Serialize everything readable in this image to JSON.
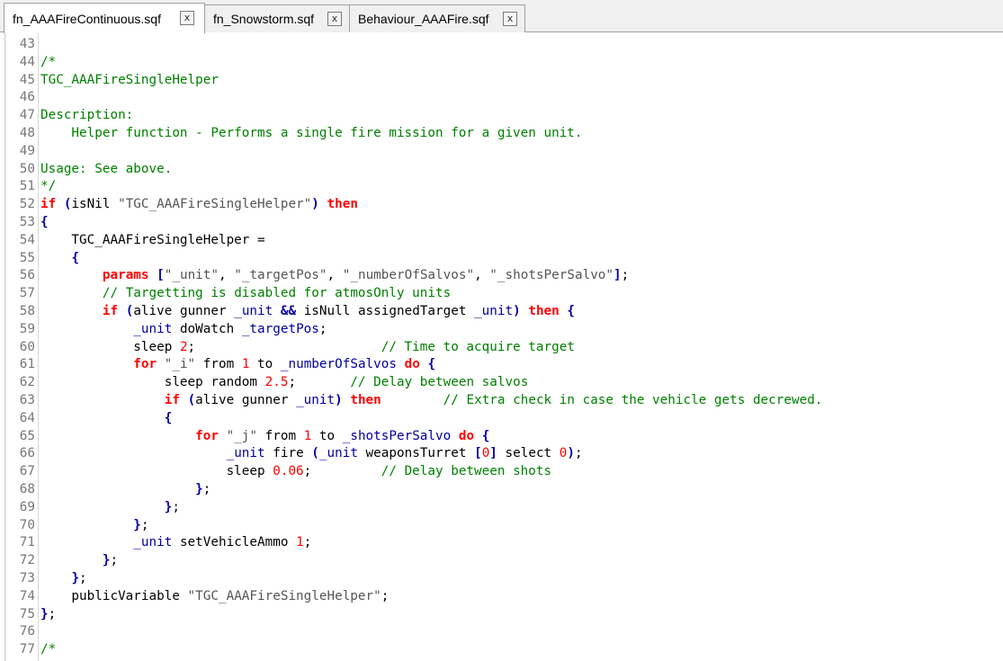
{
  "tabs": [
    {
      "label": "fn_AAAFireContinuous.sqf",
      "close": "x",
      "active": true
    },
    {
      "label": "fn_Snowstorm.sqf",
      "close": "x",
      "active": false
    },
    {
      "label": "Behaviour_AAAFire.sqf",
      "close": "x",
      "active": false
    }
  ],
  "colors": {
    "comment": "#008000",
    "keyword": "#ff0000",
    "number": "#ff0000",
    "string": "#555555",
    "variable": "#0000a0",
    "operator": "#0000a0",
    "line_number": "#777777"
  },
  "lines": [
    {
      "n": "43",
      "tokens": []
    },
    {
      "n": "44",
      "tokens": [
        {
          "t": "cmt",
          "v": "/*"
        }
      ]
    },
    {
      "n": "45",
      "tokens": [
        {
          "t": "cmt",
          "v": "TGC_AAAFireSingleHelper"
        }
      ]
    },
    {
      "n": "46",
      "tokens": []
    },
    {
      "n": "47",
      "tokens": [
        {
          "t": "cmt",
          "v": "Description:"
        }
      ]
    },
    {
      "n": "48",
      "tokens": [
        {
          "t": "cmt",
          "v": "    Helper function - Performs a single fire mission for a given unit."
        }
      ]
    },
    {
      "n": "49",
      "tokens": []
    },
    {
      "n": "50",
      "tokens": [
        {
          "t": "cmt",
          "v": "Usage: See above."
        }
      ]
    },
    {
      "n": "51",
      "tokens": [
        {
          "t": "cmt",
          "v": "*/"
        }
      ]
    },
    {
      "n": "52",
      "tokens": [
        {
          "t": "kw",
          "v": "if"
        },
        {
          "t": "plain",
          "v": " "
        },
        {
          "t": "op",
          "v": "("
        },
        {
          "t": "plain",
          "v": "isNil "
        },
        {
          "t": "str",
          "v": "\"TGC_AAAFireSingleHelper\""
        },
        {
          "t": "op",
          "v": ")"
        },
        {
          "t": "plain",
          "v": " "
        },
        {
          "t": "kw",
          "v": "then"
        }
      ]
    },
    {
      "n": "53",
      "tokens": [
        {
          "t": "op",
          "v": "{"
        }
      ]
    },
    {
      "n": "54",
      "tokens": [
        {
          "t": "plain",
          "v": "    TGC_AAAFireSingleHelper ="
        }
      ]
    },
    {
      "n": "55",
      "tokens": [
        {
          "t": "plain",
          "v": "    "
        },
        {
          "t": "op",
          "v": "{"
        }
      ]
    },
    {
      "n": "56",
      "tokens": [
        {
          "t": "plain",
          "v": "        "
        },
        {
          "t": "kw",
          "v": "params"
        },
        {
          "t": "plain",
          "v": " "
        },
        {
          "t": "op",
          "v": "["
        },
        {
          "t": "str",
          "v": "\"_unit\""
        },
        {
          "t": "plain",
          "v": ", "
        },
        {
          "t": "str",
          "v": "\"_targetPos\""
        },
        {
          "t": "plain",
          "v": ", "
        },
        {
          "t": "str",
          "v": "\"_numberOfSalvos\""
        },
        {
          "t": "plain",
          "v": ", "
        },
        {
          "t": "str",
          "v": "\"_shotsPerSalvo\""
        },
        {
          "t": "op",
          "v": "]"
        },
        {
          "t": "plain",
          "v": ";"
        }
      ]
    },
    {
      "n": "57",
      "tokens": [
        {
          "t": "plain",
          "v": "        "
        },
        {
          "t": "cmt",
          "v": "// Targetting is disabled for atmosOnly units"
        }
      ]
    },
    {
      "n": "58",
      "tokens": [
        {
          "t": "plain",
          "v": "        "
        },
        {
          "t": "kw",
          "v": "if"
        },
        {
          "t": "plain",
          "v": " "
        },
        {
          "t": "op",
          "v": "("
        },
        {
          "t": "plain",
          "v": "alive gunner "
        },
        {
          "t": "var",
          "v": "_unit"
        },
        {
          "t": "plain",
          "v": " "
        },
        {
          "t": "op",
          "v": "&&"
        },
        {
          "t": "plain",
          "v": " isNull assignedTarget "
        },
        {
          "t": "var",
          "v": "_unit"
        },
        {
          "t": "op",
          "v": ")"
        },
        {
          "t": "plain",
          "v": " "
        },
        {
          "t": "kw",
          "v": "then"
        },
        {
          "t": "plain",
          "v": " "
        },
        {
          "t": "op",
          "v": "{"
        }
      ]
    },
    {
      "n": "59",
      "tokens": [
        {
          "t": "plain",
          "v": "            "
        },
        {
          "t": "var",
          "v": "_unit"
        },
        {
          "t": "plain",
          "v": " doWatch "
        },
        {
          "t": "var",
          "v": "_targetPos"
        },
        {
          "t": "plain",
          "v": ";"
        }
      ]
    },
    {
      "n": "60",
      "tokens": [
        {
          "t": "plain",
          "v": "            sleep "
        },
        {
          "t": "num",
          "v": "2"
        },
        {
          "t": "plain",
          "v": ";                        "
        },
        {
          "t": "cmt",
          "v": "// Time to acquire target"
        }
      ]
    },
    {
      "n": "61",
      "tokens": [
        {
          "t": "plain",
          "v": "            "
        },
        {
          "t": "kw",
          "v": "for"
        },
        {
          "t": "plain",
          "v": " "
        },
        {
          "t": "str",
          "v": "\"_i\""
        },
        {
          "t": "plain",
          "v": " from "
        },
        {
          "t": "num",
          "v": "1"
        },
        {
          "t": "plain",
          "v": " to "
        },
        {
          "t": "var",
          "v": "_numberOfSalvos"
        },
        {
          "t": "plain",
          "v": " "
        },
        {
          "t": "kw",
          "v": "do"
        },
        {
          "t": "plain",
          "v": " "
        },
        {
          "t": "op",
          "v": "{"
        }
      ]
    },
    {
      "n": "62",
      "tokens": [
        {
          "t": "plain",
          "v": "                sleep random "
        },
        {
          "t": "num",
          "v": "2.5"
        },
        {
          "t": "plain",
          "v": ";       "
        },
        {
          "t": "cmt",
          "v": "// Delay between salvos"
        }
      ]
    },
    {
      "n": "63",
      "tokens": [
        {
          "t": "plain",
          "v": "                "
        },
        {
          "t": "kw",
          "v": "if"
        },
        {
          "t": "plain",
          "v": " "
        },
        {
          "t": "op",
          "v": "("
        },
        {
          "t": "plain",
          "v": "alive gunner "
        },
        {
          "t": "var",
          "v": "_unit"
        },
        {
          "t": "op",
          "v": ")"
        },
        {
          "t": "plain",
          "v": " "
        },
        {
          "t": "kw",
          "v": "then"
        },
        {
          "t": "plain",
          "v": "        "
        },
        {
          "t": "cmt",
          "v": "// Extra check in case the vehicle gets decrewed."
        }
      ]
    },
    {
      "n": "64",
      "tokens": [
        {
          "t": "plain",
          "v": "                "
        },
        {
          "t": "op",
          "v": "{"
        }
      ]
    },
    {
      "n": "65",
      "tokens": [
        {
          "t": "plain",
          "v": "                    "
        },
        {
          "t": "kw",
          "v": "for"
        },
        {
          "t": "plain",
          "v": " "
        },
        {
          "t": "str",
          "v": "\"_j\""
        },
        {
          "t": "plain",
          "v": " from "
        },
        {
          "t": "num",
          "v": "1"
        },
        {
          "t": "plain",
          "v": " to "
        },
        {
          "t": "var",
          "v": "_shotsPerSalvo"
        },
        {
          "t": "plain",
          "v": " "
        },
        {
          "t": "kw",
          "v": "do"
        },
        {
          "t": "plain",
          "v": " "
        },
        {
          "t": "op",
          "v": "{"
        }
      ]
    },
    {
      "n": "66",
      "tokens": [
        {
          "t": "plain",
          "v": "                        "
        },
        {
          "t": "var",
          "v": "_unit"
        },
        {
          "t": "plain",
          "v": " fire "
        },
        {
          "t": "op",
          "v": "("
        },
        {
          "t": "var",
          "v": "_unit"
        },
        {
          "t": "plain",
          "v": " weaponsTurret "
        },
        {
          "t": "op",
          "v": "["
        },
        {
          "t": "num",
          "v": "0"
        },
        {
          "t": "op",
          "v": "]"
        },
        {
          "t": "plain",
          "v": " select "
        },
        {
          "t": "num",
          "v": "0"
        },
        {
          "t": "op",
          "v": ")"
        },
        {
          "t": "plain",
          "v": ";"
        }
      ]
    },
    {
      "n": "67",
      "tokens": [
        {
          "t": "plain",
          "v": "                        sleep "
        },
        {
          "t": "num",
          "v": "0.06"
        },
        {
          "t": "plain",
          "v": ";         "
        },
        {
          "t": "cmt",
          "v": "// Delay between shots"
        }
      ]
    },
    {
      "n": "68",
      "tokens": [
        {
          "t": "plain",
          "v": "                    "
        },
        {
          "t": "op",
          "v": "}"
        },
        {
          "t": "plain",
          "v": ";"
        }
      ]
    },
    {
      "n": "69",
      "tokens": [
        {
          "t": "plain",
          "v": "                "
        },
        {
          "t": "op",
          "v": "}"
        },
        {
          "t": "plain",
          "v": ";"
        }
      ]
    },
    {
      "n": "70",
      "tokens": [
        {
          "t": "plain",
          "v": "            "
        },
        {
          "t": "op",
          "v": "}"
        },
        {
          "t": "plain",
          "v": ";"
        }
      ]
    },
    {
      "n": "71",
      "tokens": [
        {
          "t": "plain",
          "v": "            "
        },
        {
          "t": "var",
          "v": "_unit"
        },
        {
          "t": "plain",
          "v": " setVehicleAmmo "
        },
        {
          "t": "num",
          "v": "1"
        },
        {
          "t": "plain",
          "v": ";"
        }
      ]
    },
    {
      "n": "72",
      "tokens": [
        {
          "t": "plain",
          "v": "        "
        },
        {
          "t": "op",
          "v": "}"
        },
        {
          "t": "plain",
          "v": ";"
        }
      ]
    },
    {
      "n": "73",
      "tokens": [
        {
          "t": "plain",
          "v": "    "
        },
        {
          "t": "op",
          "v": "}"
        },
        {
          "t": "plain",
          "v": ";"
        }
      ]
    },
    {
      "n": "74",
      "tokens": [
        {
          "t": "plain",
          "v": "    publicVariable "
        },
        {
          "t": "str",
          "v": "\"TGC_AAAFireSingleHelper\""
        },
        {
          "t": "plain",
          "v": ";"
        }
      ]
    },
    {
      "n": "75",
      "tokens": [
        {
          "t": "op",
          "v": "}"
        },
        {
          "t": "plain",
          "v": ";"
        }
      ]
    },
    {
      "n": "76",
      "tokens": []
    },
    {
      "n": "77",
      "tokens": [
        {
          "t": "cmt",
          "v": "/*"
        }
      ]
    }
  ]
}
